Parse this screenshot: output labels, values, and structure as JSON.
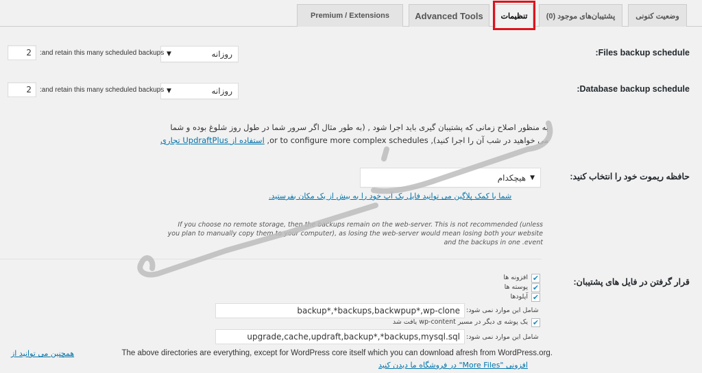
{
  "tabs": [
    {
      "label": "وضعیت کنونی",
      "active": false
    },
    {
      "label": "پشتیبان‌های موجود (0)",
      "active": false
    },
    {
      "label": "تنظیمات",
      "active": true
    },
    {
      "label": "Advanced Tools",
      "active": false
    },
    {
      "label": "Premium / Extensions",
      "active": false
    }
  ],
  "highlight_color": "#e0101a",
  "files_schedule": {
    "label": ":Files backup schedule",
    "interval": "روزانه",
    "retain_label": ":and retain this many scheduled backups",
    "retain_value": "2"
  },
  "database_schedule": {
    "label": ":Database backup schedule",
    "interval": "روزانه",
    "retain_label": ":and retain this many scheduled backups",
    "retain_value": "2"
  },
  "schedule_description": {
    "line1": "به منظور اصلاح زمانی که پشتیبان گیری باید اجرا شود , (به طور مثال اگر سرور شما در طول روز شلوغ بوده و شما",
    "line2_text": "می خواهید در شب آن را اجرا کنید), or to configure more complex schedules, ",
    "line2_link": "استفاده از UpdraftPlus تجاری"
  },
  "remote_storage": {
    "label": "حافظه ریموت خود را انتخاب کنید:",
    "selected": "هیچکدام",
    "link": "شما با کمک پلاگین می توانید فایل بک آپ خود را به بیش از یک مکان بفرستید.",
    "note": "If you choose no remote storage, then the backups remain on the web-server. This is not recommended (unless you plan to manually copy them to your computer), as losing the web-server would mean losing both your website and the backups in one .event"
  },
  "include_files": {
    "label": "قرار گرفتن در فایل های پشتیبان:",
    "checkboxes": [
      {
        "label": "افزونه ها",
        "checked": true
      },
      {
        "label": "پوسته ها",
        "checked": true
      },
      {
        "label": "آپلودها",
        "checked": true
      }
    ],
    "uploads_exclude_label": "شامل این موارد نمی شود:",
    "uploads_exclude_value": "backup*,*backups,backwpup*,wp-clone",
    "other_dirs_label": "یک پوشه ی دیگر در مسیر wp-content یافت شد",
    "other_dirs_checked": true,
    "others_exclude_label": "شامل این موارد نمی شود:",
    "others_exclude_value": "upgrade,cache,updraft,backup*,*backups,mysql.sql",
    "footer_text": "The above directories are everything, except for WordPress core itself which you can download afresh from WordPress.org.",
    "footer_link1": "همچنین می توانید از",
    "footer_link2": "افزونی \"More Files\" در فروشگاه ما دیدن کنید"
  }
}
